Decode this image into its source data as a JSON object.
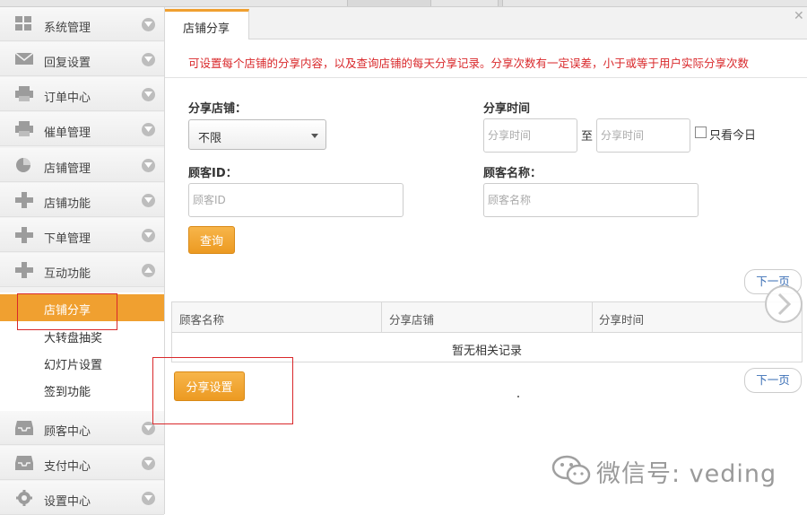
{
  "sidebar": {
    "items": [
      {
        "label": "系统管理",
        "icon": "grid-icon"
      },
      {
        "label": "回复设置",
        "icon": "envelope-icon"
      },
      {
        "label": "订单中心",
        "icon": "printer-icon"
      },
      {
        "label": "催单管理",
        "icon": "printer-icon"
      },
      {
        "label": "店铺管理",
        "icon": "pie-chart-icon"
      },
      {
        "label": "店铺功能",
        "icon": "plus-icon"
      },
      {
        "label": "下单管理",
        "icon": "plus-icon"
      },
      {
        "label": "互动功能",
        "icon": "plus-icon"
      }
    ],
    "sub_items": [
      {
        "label": "店铺分享",
        "active": true
      },
      {
        "label": "大转盘抽奖"
      },
      {
        "label": "幻灯片设置"
      },
      {
        "label": "签到功能"
      }
    ],
    "bottom_items": [
      {
        "label": "顾客中心",
        "icon": "inbox-icon"
      },
      {
        "label": "支付中心",
        "icon": "inbox-icon"
      },
      {
        "label": "设置中心",
        "icon": "gear-icon"
      }
    ]
  },
  "tab": {
    "label": "店铺分享"
  },
  "notice": "可设置每个店铺的分享内容，以及查询店铺的每天分享记录。分享次数有一定误差，小于或等于用户实际分享次数",
  "form": {
    "shop_label": "分享店铺：",
    "shop_value": "不限",
    "time_label": "分享时间",
    "time_start_placeholder": "分享时间",
    "to_text": "至",
    "time_end_placeholder": "分享时间",
    "today_only_label": "只看今日",
    "customer_id_label": "顾客ID：",
    "customer_id_placeholder": "顾客ID",
    "customer_name_label": "顾客名称：",
    "customer_name_placeholder": "顾客名称",
    "query_button": "查询"
  },
  "pager": {
    "next_label": "下一页"
  },
  "table": {
    "columns": [
      "顾客名称",
      "分享店铺",
      "分享时间"
    ],
    "empty_text": "暂无相关记录"
  },
  "share_settings_button": "分享设置",
  "watermark": "微信号: veding",
  "colors": {
    "accent": "#f0a030",
    "notice": "#d9282b",
    "highlight_box": "#d9282b"
  }
}
